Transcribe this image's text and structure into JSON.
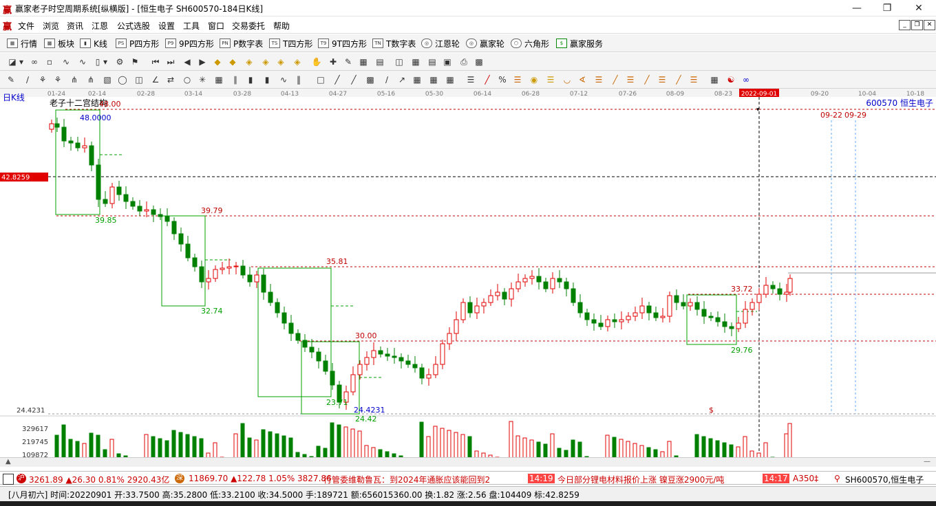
{
  "titlebar": {
    "title": "赢家老子时空周期系统[纵横版] - [恒生电子  SH600570-184日K线]",
    "logo": "赢"
  },
  "menubar": {
    "logo": "赢",
    "items": [
      "文件",
      "浏览",
      "资讯",
      "江恩",
      "公式选股",
      "设置",
      "工具",
      "窗口",
      "交易委托",
      "帮助"
    ]
  },
  "toolbar1": {
    "items": [
      {
        "label": "行情",
        "icon": "grid"
      },
      {
        "label": "板块",
        "icon": "sector"
      },
      {
        "label": "K线",
        "icon": "kline"
      },
      {
        "label": "P四方形",
        "icon": "PS"
      },
      {
        "label": "9P四方形",
        "icon": "P9"
      },
      {
        "label": "P数字表",
        "icon": "PN"
      },
      {
        "label": "T四方形",
        "icon": "TS"
      },
      {
        "label": "9T四方形",
        "icon": "T9"
      },
      {
        "label": "T数字表",
        "icon": "TN"
      },
      {
        "label": "江恩轮",
        "icon": "wheel"
      },
      {
        "label": "赢家轮",
        "icon": "wheel2"
      },
      {
        "label": "六角形",
        "icon": "hex"
      },
      {
        "label": "赢家服务",
        "icon": "$"
      }
    ]
  },
  "chart_title": "日K线",
  "chart_indicator": "老子十二宫结构",
  "stock_label": "600570  恒生电子",
  "date_ticks": [
    "01-24",
    "02-14",
    "02-28",
    "03-14",
    "03-28",
    "04-13",
    "04-27",
    "05-16",
    "05-30",
    "06-14",
    "06-28",
    "07-12",
    "07-26",
    "08-09",
    "08-23",
    "2022-09-01",
    "09-20",
    "10-04",
    "10-18"
  ],
  "current_price_label": "42.8259",
  "low_label": "24.4231",
  "volume_labels": [
    "329617",
    "219745",
    "109872"
  ],
  "level_labels": [
    "48.00",
    "39.79",
    "35.81",
    "30.00",
    "33.72"
  ],
  "low_labels": [
    "48.0000",
    "39.85",
    "32.74",
    "23.71",
    "24.4231",
    "24.42",
    "29.76"
  ],
  "future_dates": [
    "09-22",
    "09-29"
  ],
  "dollar_mark": "$",
  "ticker": {
    "sh_index": "3261.89 ▲26.30 0.81% 2920.43亿",
    "sz_index": "11869.70 ▲122.78 1.05% 3827.86",
    "news1": "行管委维勒鲁瓦：到2024年通胀应该能回到2",
    "time1": "14:19",
    "news2": "今日部分锂电材料报价上涨 镍豆涨2900元/吨",
    "time2": "14:17",
    "extra": "A350‡",
    "stock": "SH600570,恒生电子"
  },
  "status": "[八月初六] 时间:20220901 开:33.7500 高:35.2800 低:33.2100 收:34.5000 手:189721 额:656015360.00 换:1.82 涨:2.56 盘:104409 标:42.8259",
  "colors": {
    "up": "#e00000",
    "down": "#008000",
    "box": "#00a000",
    "level": "#c00000",
    "blue": "#0000cc"
  }
}
